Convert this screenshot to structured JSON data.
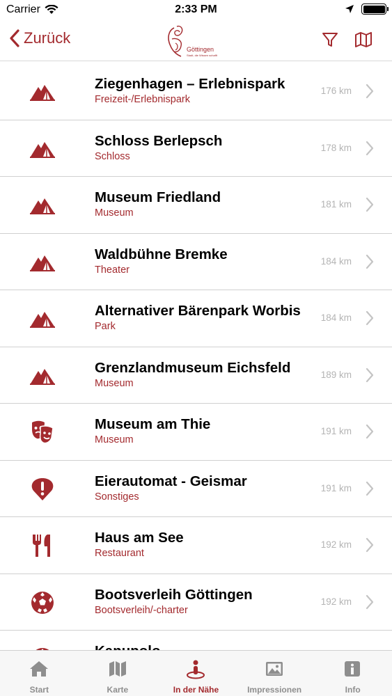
{
  "status": {
    "carrier": "Carrier",
    "time": "2:33 PM"
  },
  "nav": {
    "back_label": "Zurück",
    "logo_text": "Göttingen",
    "logo_tagline": "Stadt, die Wissen schafft"
  },
  "colors": {
    "accent": "#a32a2e",
    "muted": "#b4b4b4",
    "tab_inactive": "#8e8e8e"
  },
  "items": [
    {
      "title": "Ziegenhagen – Erlebnispark",
      "category": "Freizeit-/Erlebnispark",
      "distance": "176 km",
      "icon": "tent-icon"
    },
    {
      "title": "Schloss Berlepsch",
      "category": "Schloss",
      "distance": "178 km",
      "icon": "tent-icon"
    },
    {
      "title": "Museum Friedland",
      "category": "Museum",
      "distance": "181 km",
      "icon": "tent-icon"
    },
    {
      "title": "Waldbühne Bremke",
      "category": "Theater",
      "distance": "184 km",
      "icon": "tent-icon"
    },
    {
      "title": "Alternativer Bärenpark Worbis",
      "category": "Park",
      "distance": "184 km",
      "icon": "tent-icon"
    },
    {
      "title": "Grenzlandmuseum Eichsfeld",
      "category": "Museum",
      "distance": "189 km",
      "icon": "tent-icon"
    },
    {
      "title": "Museum am Thie",
      "category": "Museum",
      "distance": "191 km",
      "icon": "theater-masks-icon"
    },
    {
      "title": "Eierautomat - Geismar",
      "category": "Sonstiges",
      "distance": "191 km",
      "icon": "exclamation-pin-icon"
    },
    {
      "title": "Haus am See",
      "category": "Restaurant",
      "distance": "192 km",
      "icon": "fork-knife-icon"
    },
    {
      "title": "Bootsverleih Göttingen",
      "category": "Bootsverleih/-charter",
      "distance": "192 km",
      "icon": "soccer-ball-icon"
    },
    {
      "title": "Kanupolo",
      "category": "",
      "distance": "",
      "icon": "soccer-ball-icon"
    }
  ],
  "tabs": [
    {
      "label": "Start",
      "icon": "home-icon",
      "active": false
    },
    {
      "label": "Karte",
      "icon": "map-icon",
      "active": false
    },
    {
      "label": "In der Nähe",
      "icon": "location-person-icon",
      "active": true
    },
    {
      "label": "Impressionen",
      "icon": "photo-icon",
      "active": false
    },
    {
      "label": "Info",
      "icon": "info-icon",
      "active": false
    }
  ]
}
